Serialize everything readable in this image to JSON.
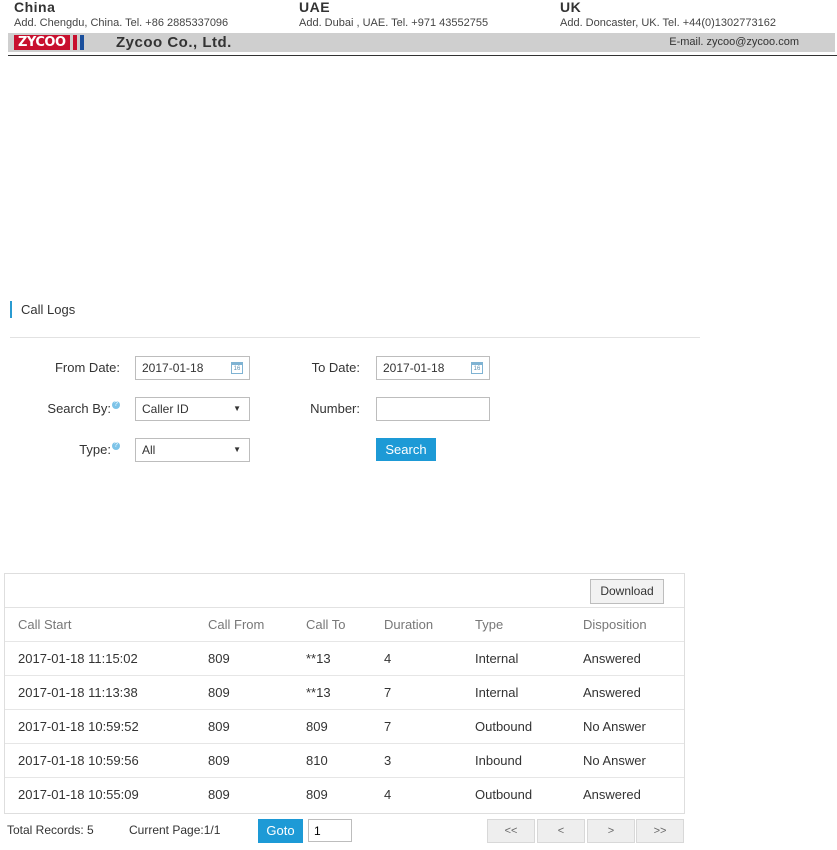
{
  "header": {
    "offices": [
      {
        "country": "China",
        "address": "Add. Chengdu, China.   Tel. +86 2885337096"
      },
      {
        "country": "UAE",
        "address": "Add. Dubai , UAE.   Tel. +971 43552755"
      },
      {
        "country": "UK",
        "address": "Add. Doncaster, UK.   Tel. +44(0)1302773162"
      }
    ],
    "logo_text": "ZYCOO",
    "company": "Zycoo  Co., Ltd.",
    "email": "E-mail. zycoo@zycoo.com"
  },
  "section": {
    "title": "Call Logs"
  },
  "form": {
    "from_date_label": "From Date:",
    "from_date_value": "2017-01-18",
    "to_date_label": "To Date:",
    "to_date_value": "2017-01-18",
    "search_by_label": "Search By:",
    "search_by_value": "Caller ID",
    "number_label": "Number:",
    "number_value": "",
    "type_label": "Type:",
    "type_value": "All",
    "help_glyph": "?",
    "calendar_glyph": "16",
    "search_button": "Search"
  },
  "table": {
    "download_button": "Download",
    "columns": [
      "Call Start",
      "Call From",
      "Call To",
      "Duration",
      "Type",
      "Disposition"
    ],
    "rows": [
      [
        "2017-01-18 11:15:02",
        "809",
        "**13",
        "4",
        "Internal",
        "Answered"
      ],
      [
        "2017-01-18 11:13:38",
        "809",
        "**13",
        "7",
        "Internal",
        "Answered"
      ],
      [
        "2017-01-18 10:59:52",
        "809",
        "809",
        "7",
        "Outbound",
        "No Answer"
      ],
      [
        "2017-01-18 10:59:56",
        "809",
        "810",
        "3",
        "Inbound",
        "No Answer"
      ],
      [
        "2017-01-18 10:55:09",
        "809",
        "809",
        "4",
        "Outbound",
        "Answered"
      ]
    ]
  },
  "pager": {
    "total_records": "Total Records: 5",
    "current_page": "Current Page:1/1",
    "goto_button": "Goto",
    "goto_value": "1",
    "first": "<<",
    "prev": "<",
    "next": ">",
    "last": ">>"
  },
  "colors": {
    "accent": "#1d9ad6",
    "logo_red": "#c8102e"
  }
}
